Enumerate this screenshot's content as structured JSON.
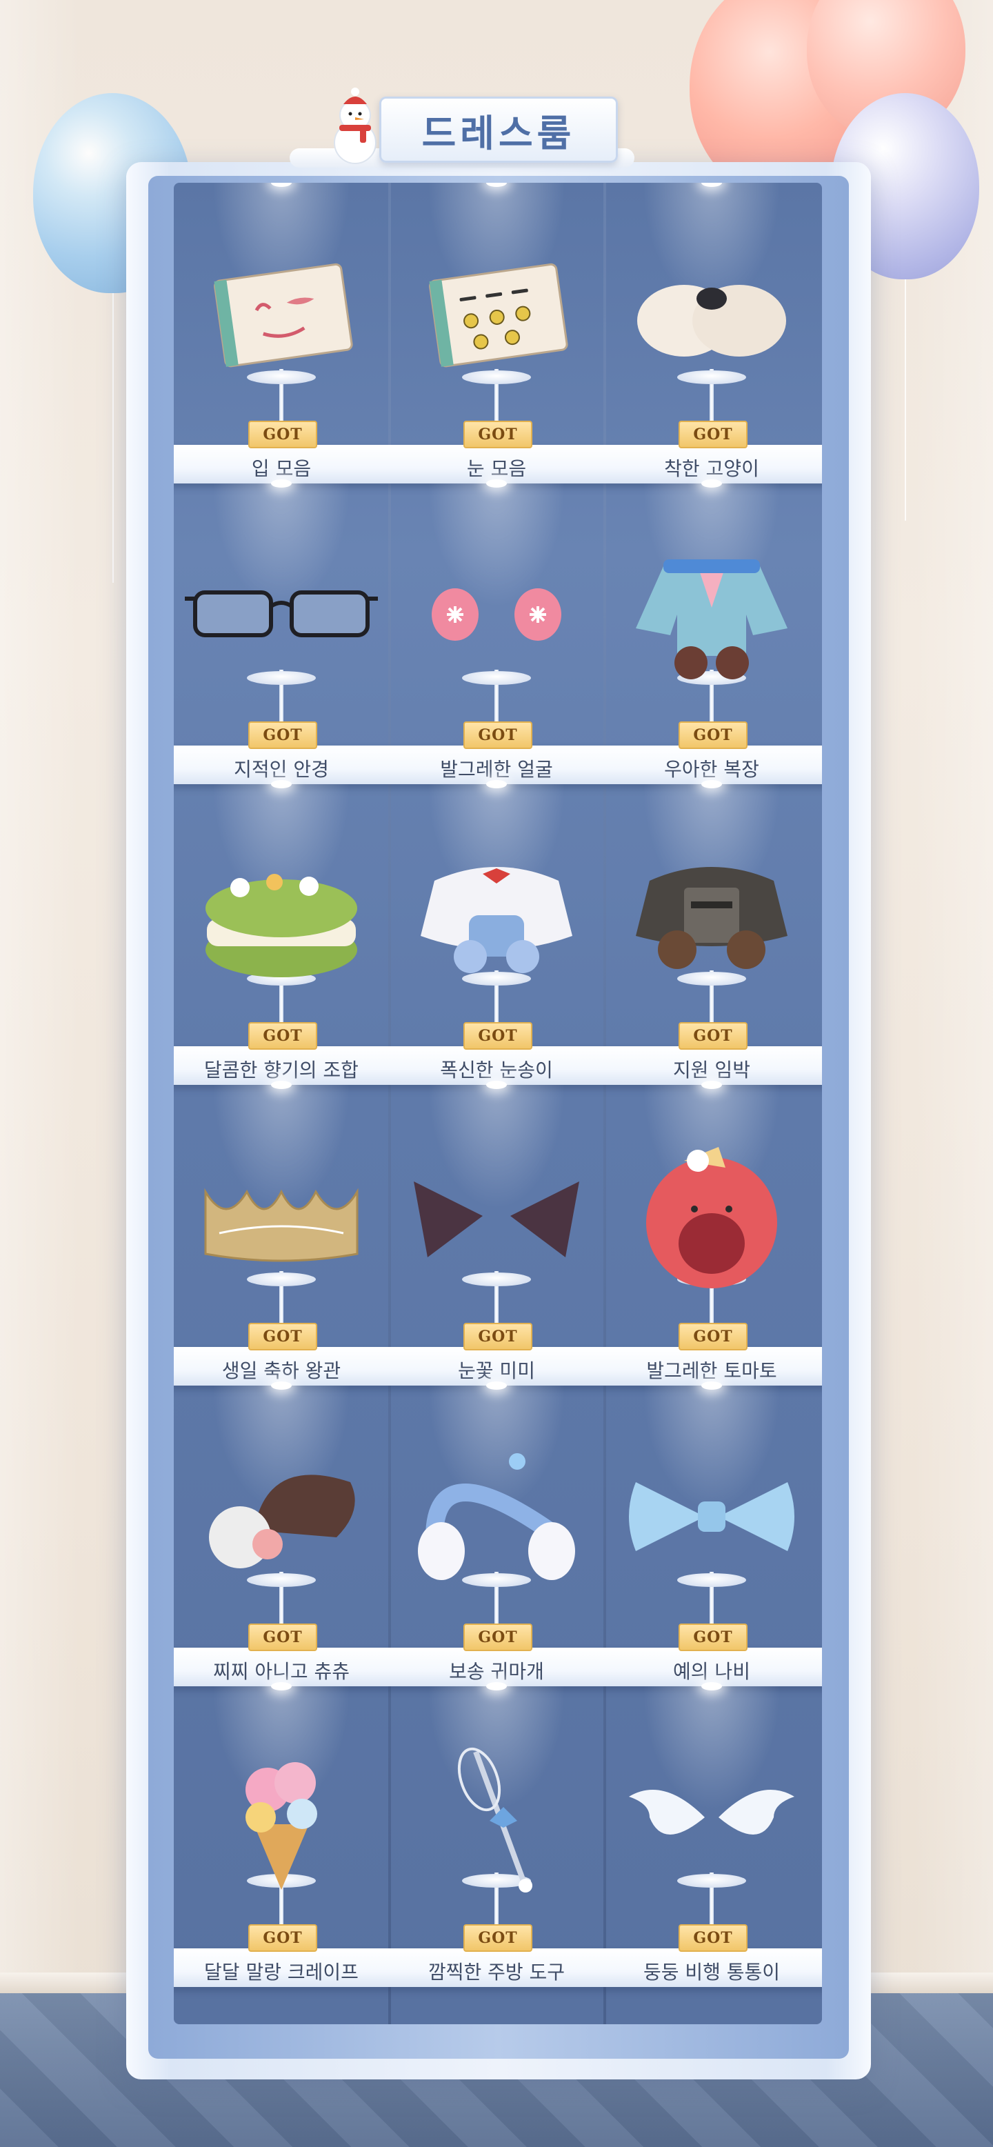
{
  "header": {
    "title": "드레스룸"
  },
  "badge_text": "GOT",
  "items": [
    {
      "name": "입 모음",
      "icon": "mouth-set-icon"
    },
    {
      "name": "눈 모음",
      "icon": "eyes-set-icon"
    },
    {
      "name": "착한 고양이",
      "icon": "cat-muzzle-icon"
    },
    {
      "name": "지적인 안경",
      "icon": "glasses-icon"
    },
    {
      "name": "발그레한 얼굴",
      "icon": "blush-icon"
    },
    {
      "name": "우아한 복장",
      "icon": "elegant-outfit-icon"
    },
    {
      "name": "달콤한 향기의 조합",
      "icon": "macaron-icon"
    },
    {
      "name": "폭신한 눈송이",
      "icon": "snowflake-outfit-icon"
    },
    {
      "name": "지원 임박",
      "icon": "armor-outfit-icon"
    },
    {
      "name": "생일 축하 왕관",
      "icon": "crown-icon"
    },
    {
      "name": "눈꽃 미미",
      "icon": "dark-ears-icon"
    },
    {
      "name": "발그레한 토마토",
      "icon": "tomato-hat-icon"
    },
    {
      "name": "찌찌 아니고 츄츄",
      "icon": "fur-hat-icon"
    },
    {
      "name": "보송 귀마개",
      "icon": "earmuffs-icon"
    },
    {
      "name": "예의 나비",
      "icon": "bow-icon"
    },
    {
      "name": "달달 말랑 크레이프",
      "icon": "ice-cream-icon"
    },
    {
      "name": "깜찍한 주방 도구",
      "icon": "whisk-icon"
    },
    {
      "name": "둥둥 비행 통통이",
      "icon": "wings-icon"
    }
  ],
  "colors": {
    "cabinet_inner": "#5f7aaa",
    "badge": "#f1c66a",
    "label_text": "#3f4c66",
    "title": "#4f6fa6"
  }
}
